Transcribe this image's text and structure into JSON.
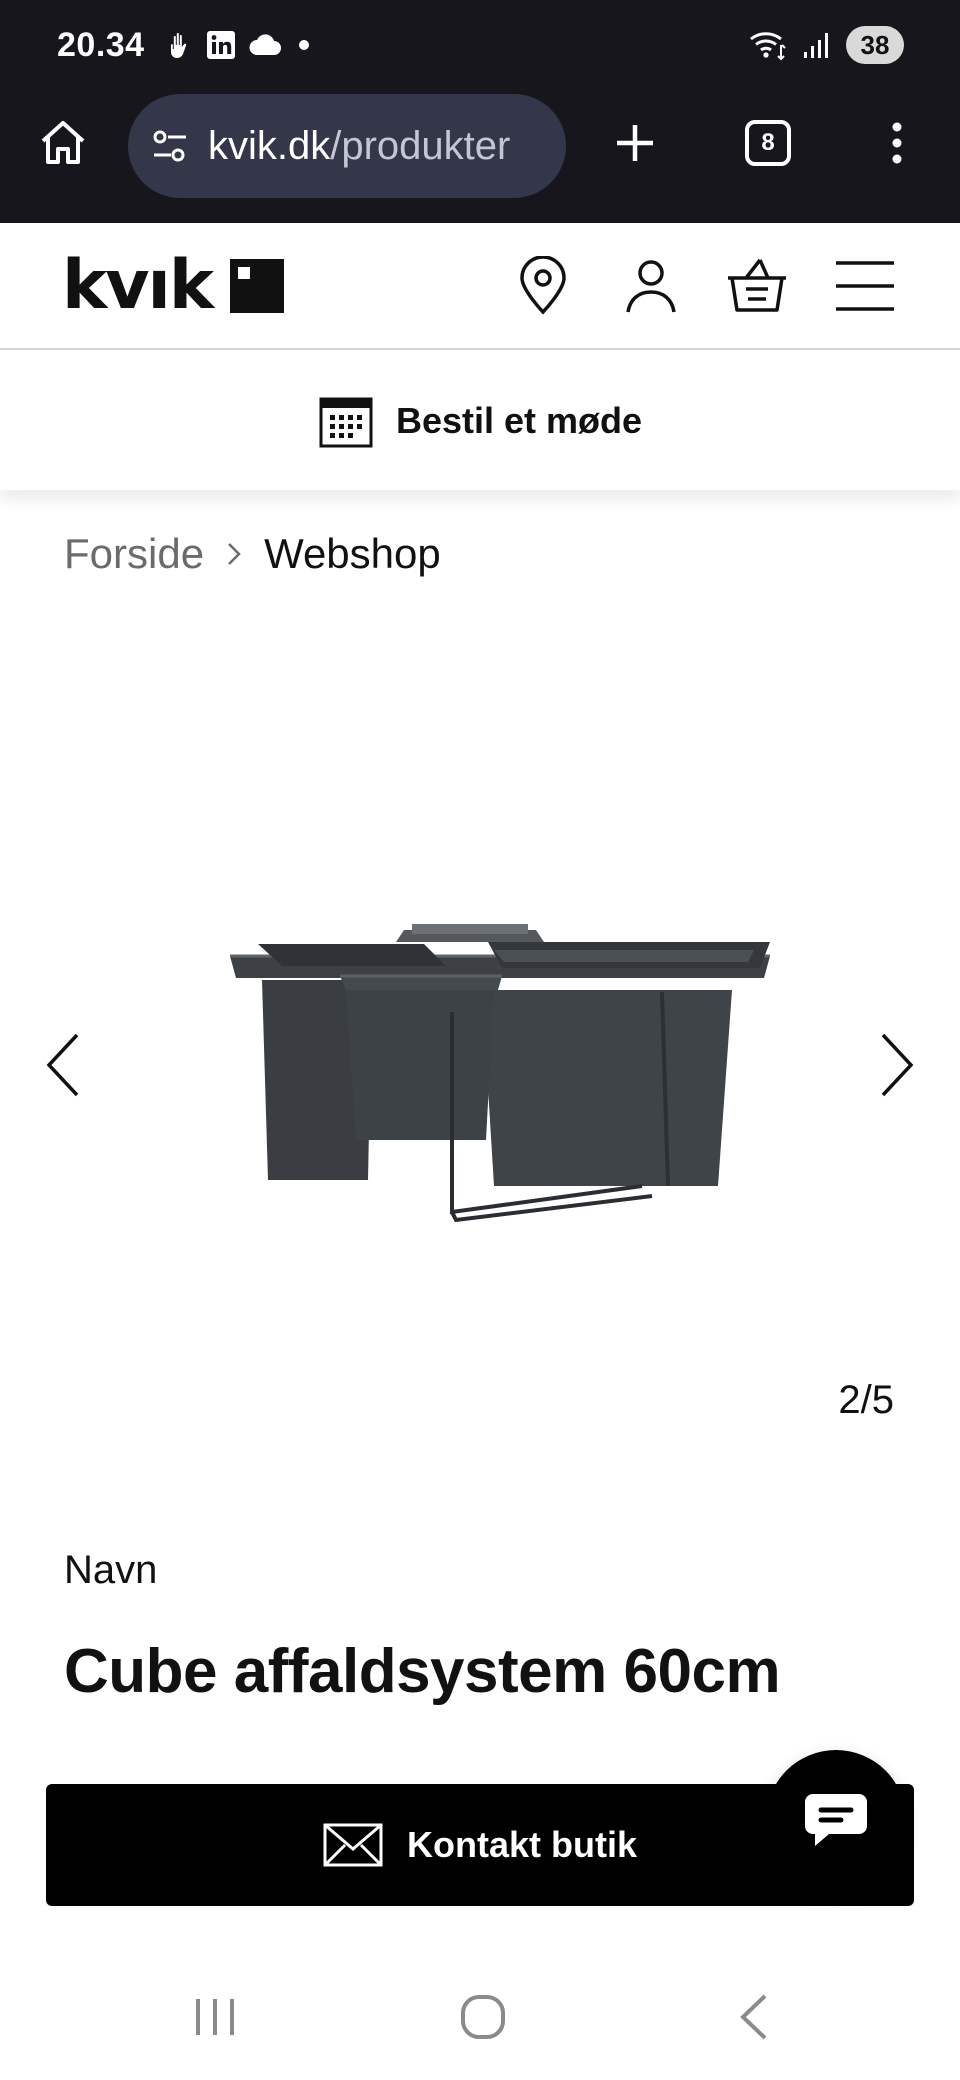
{
  "status_bar": {
    "time": "20.34",
    "battery": "38",
    "icons": [
      "hand-icon",
      "linkedin-icon",
      "cloud-icon",
      "dot-icon",
      "wifi-icon",
      "signal-icon"
    ]
  },
  "browser": {
    "url_host": "kvik.dk",
    "url_path": "/produkter",
    "tabs_count": "8"
  },
  "site": {
    "logo": "kvık",
    "header_icons": [
      "location-pin-icon",
      "account-icon",
      "basket-icon",
      "hamburger-menu-icon"
    ]
  },
  "meeting": {
    "label": "Bestil et møde"
  },
  "breadcrumb": {
    "home": "Forside",
    "current": "Webshop"
  },
  "gallery": {
    "counter": "2/5",
    "image": "cube-waste-system-image"
  },
  "product": {
    "name_label": "Navn",
    "title": "Cube affaldsystem 60cm"
  },
  "cta": {
    "contact_label": "Kontakt butik"
  },
  "colors": {
    "chrome_bg": "#16161c",
    "url_pill_bg": "#34364a",
    "cta_bg": "#000000",
    "muted_text": "#6b6b6b"
  }
}
